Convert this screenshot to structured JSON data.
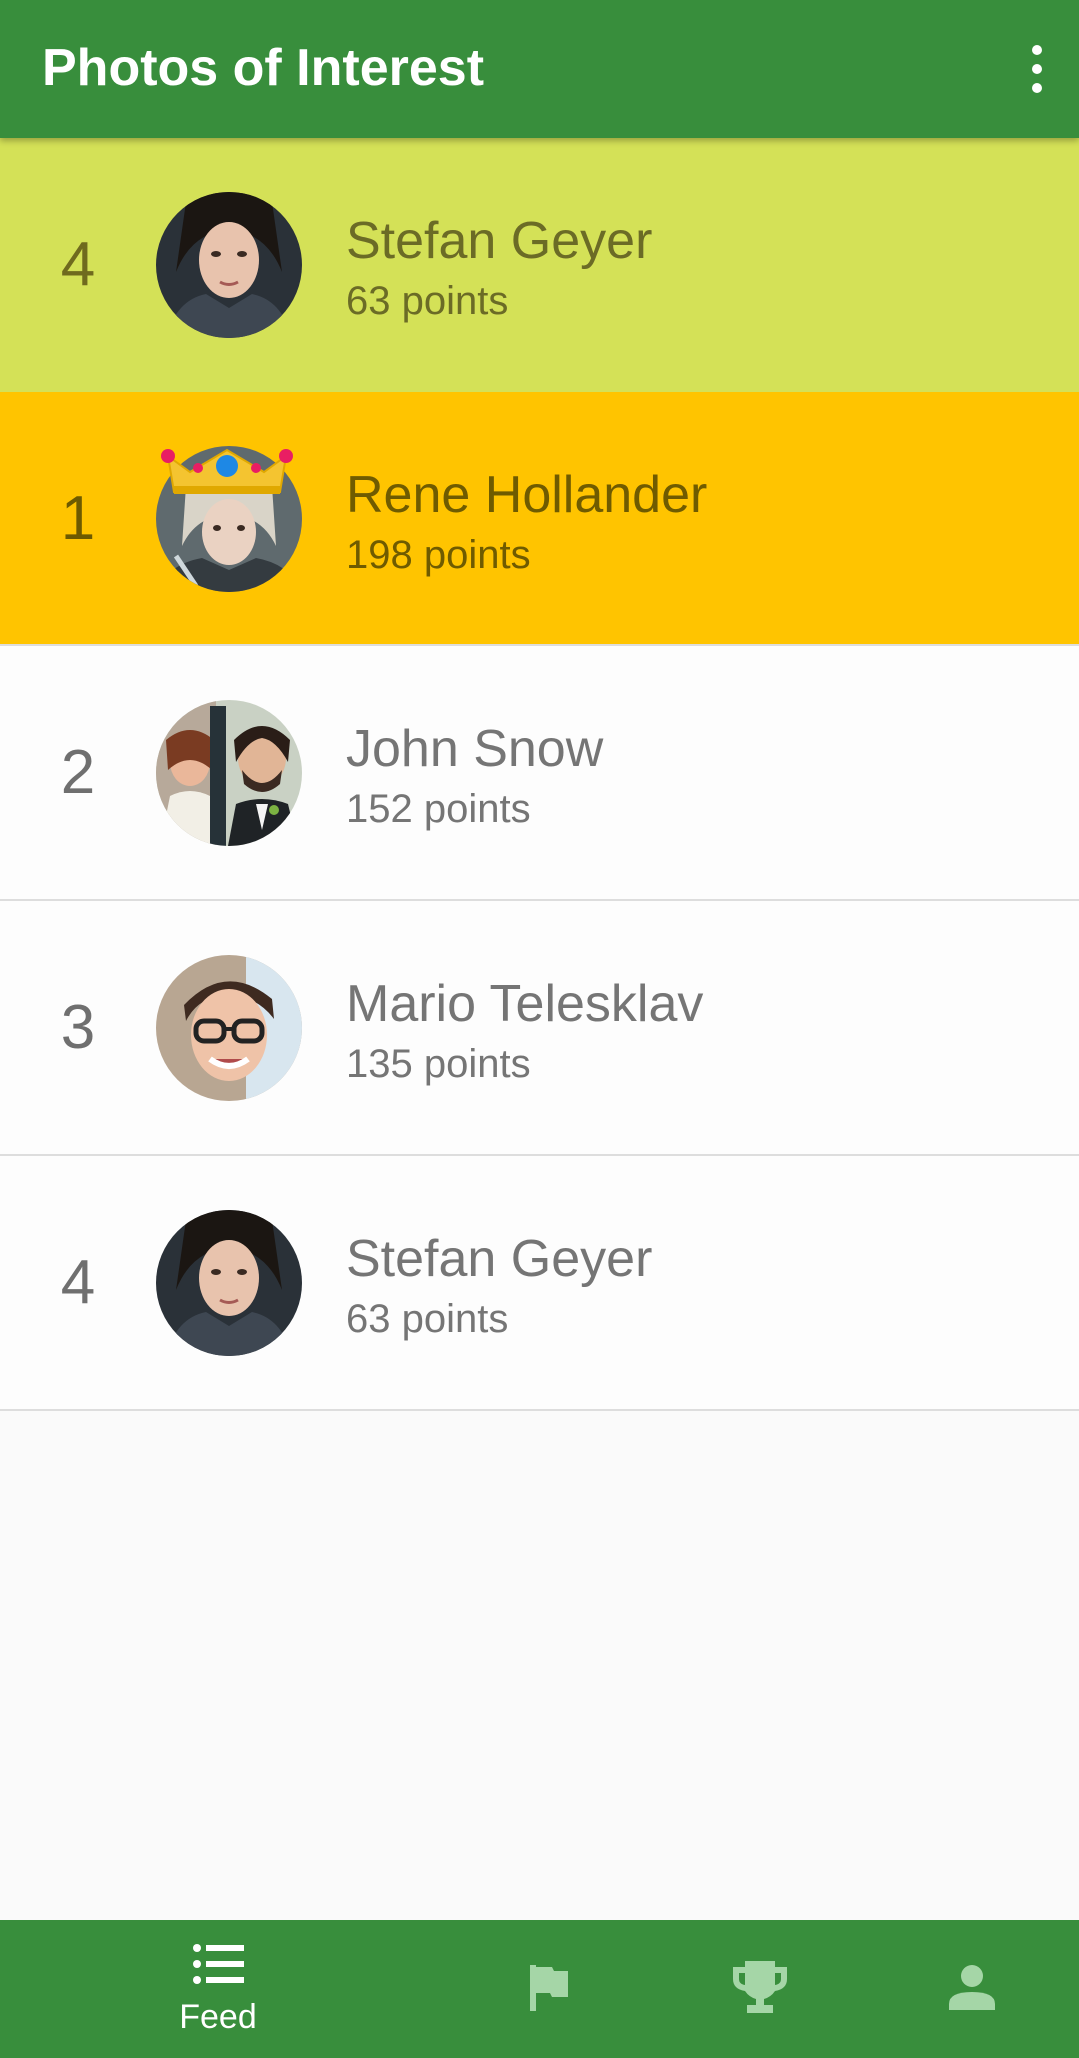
{
  "appbar": {
    "title": "Photos of Interest",
    "menu_icon": "more-vert-icon"
  },
  "colors": {
    "primary": "#388e3c",
    "self_highlight": "#d4e157",
    "leader_highlight": "#ffc400"
  },
  "current_user": {
    "rank": "4",
    "name": "Stefan Geyer",
    "points": "63 points"
  },
  "leaderboard": [
    {
      "rank": "1",
      "name": "Rene Hollander",
      "points": "198 points",
      "badge": "crown-icon"
    },
    {
      "rank": "2",
      "name": "John Snow",
      "points": "152 points"
    },
    {
      "rank": "3",
      "name": "Mario Telesklav",
      "points": "135 points"
    },
    {
      "rank": "4",
      "name": "Stefan Geyer",
      "points": "63 points"
    }
  ],
  "bottom_nav": {
    "items": [
      {
        "label": "Feed",
        "icon": "list-icon",
        "active": true
      },
      {
        "label": "",
        "icon": "flag-icon",
        "active": false
      },
      {
        "label": "",
        "icon": "trophy-icon",
        "active": false
      },
      {
        "label": "",
        "icon": "person-icon",
        "active": false
      }
    ]
  }
}
